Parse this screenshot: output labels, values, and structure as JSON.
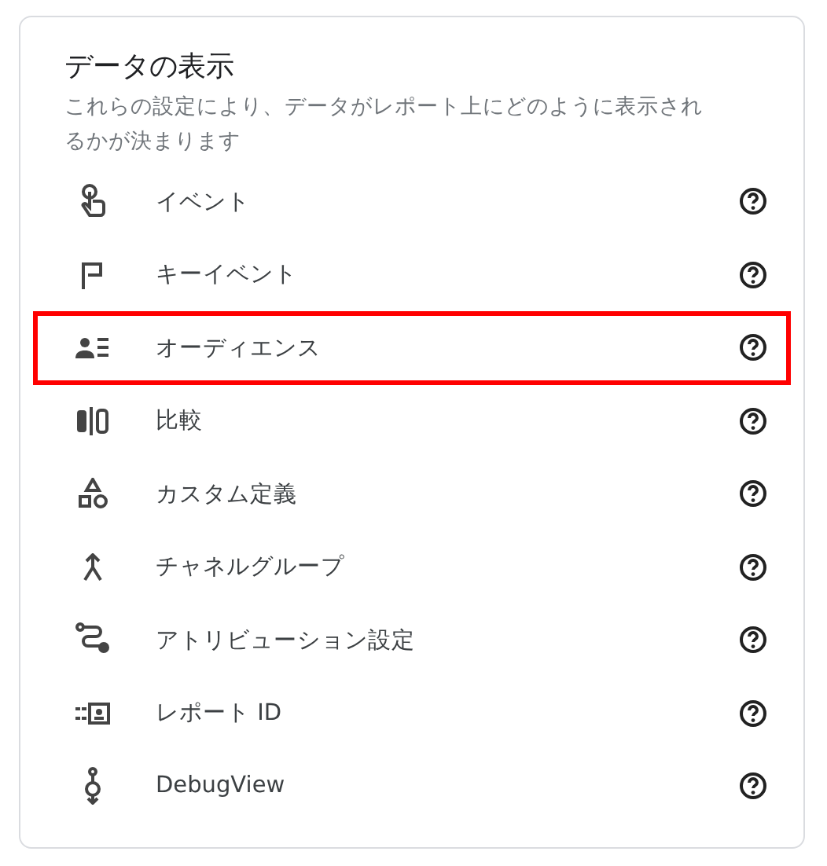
{
  "title": "データの表示",
  "description": "これらの設定により、データがレポート上にどのように表示されるかが決まります",
  "items": [
    {
      "label": "イベント",
      "highlighted": false
    },
    {
      "label": "キーイベント",
      "highlighted": false
    },
    {
      "label": "オーディエンス",
      "highlighted": true
    },
    {
      "label": "比較",
      "highlighted": false
    },
    {
      "label": "カスタム定義",
      "highlighted": false
    },
    {
      "label": "チャネルグループ",
      "highlighted": false
    },
    {
      "label": "アトリビューション設定",
      "highlighted": false
    },
    {
      "label": "レポート ID",
      "highlighted": false
    },
    {
      "label": "DebugView",
      "highlighted": false
    }
  ]
}
